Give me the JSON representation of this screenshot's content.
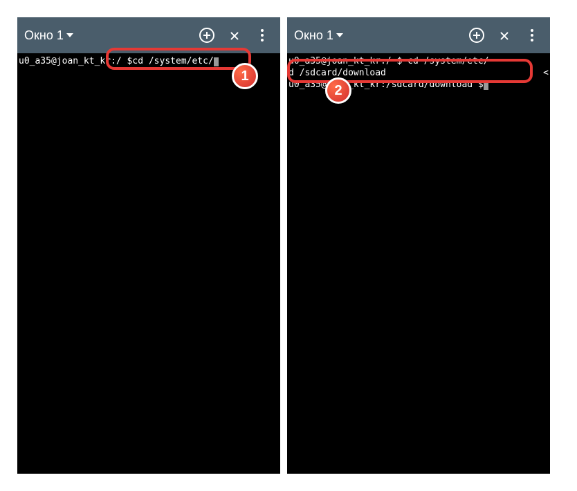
{
  "left": {
    "toolbar": {
      "title": "Окно 1"
    },
    "terminal": {
      "line1_prompt": "u0_a35@joan_kt_kr:/ $ ",
      "line1_cmd": "cd /system/etc/"
    },
    "badge": "1"
  },
  "right": {
    "toolbar": {
      "title": "Окно 1"
    },
    "terminal": {
      "line1": "u0_a35@joan_kt_kr:/ $ cd /system/etc/",
      "line2_left": "d /sdcard/download",
      "line2_right": "<",
      "line3": "u0_a35@joan_kt_kr:/sdcard/download $ "
    },
    "badge": "2"
  }
}
